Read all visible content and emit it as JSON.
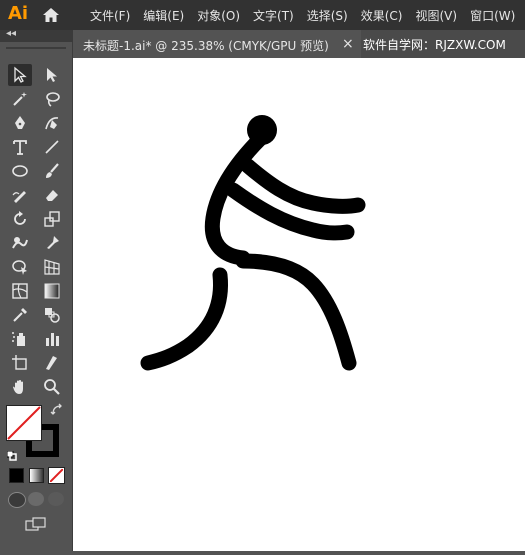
{
  "app": {
    "logo": "Ai"
  },
  "menu": [
    "文件(F)",
    "编辑(E)",
    "对象(O)",
    "文字(T)",
    "选择(S)",
    "效果(C)",
    "视图(V)",
    "窗口(W)"
  ],
  "document_tab": {
    "title": "未标题-1.ai* @ 235.38% (CMYK/GPU 预览)",
    "close": "×"
  },
  "brand_tab": "软件自学网：RJZXW.COM",
  "toolbar": {
    "collapse": "◂◂"
  },
  "colors": {
    "menubar": "#323232",
    "panel": "#535353",
    "canvas": "#ffffff",
    "logo": "#ff9a00",
    "stroke": "#000000",
    "none_slash": "#e02020"
  },
  "icons": [
    "selection-icon",
    "direct-selection-icon",
    "magic-wand-icon",
    "lasso-icon",
    "pen-icon",
    "curvature-icon",
    "type-icon",
    "line-segment-icon",
    "ellipse-icon",
    "paintbrush-icon",
    "shaper-icon",
    "eraser-icon",
    "rotate-icon",
    "scale-icon",
    "warp-icon",
    "puppet-warp-icon",
    "shape-builder-icon",
    "perspective-grid-icon",
    "mesh-icon",
    "gradient-icon",
    "eyedropper-icon",
    "blend-icon",
    "symbol-sprayer-icon",
    "column-graph-icon",
    "artboard-icon",
    "slice-icon",
    "hand-icon",
    "zoom-icon"
  ]
}
